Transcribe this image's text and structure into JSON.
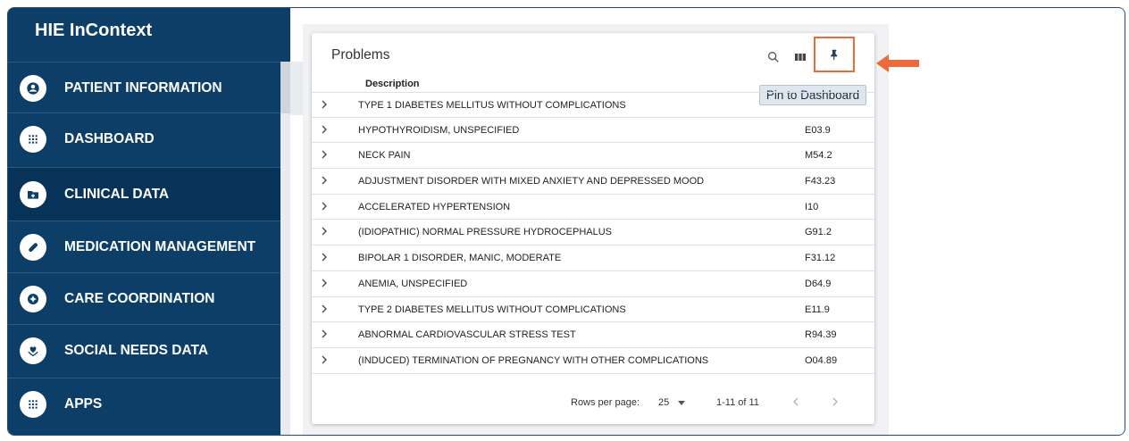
{
  "app": {
    "title": "HIE InContext"
  },
  "sidebar": {
    "items": [
      {
        "label": "PATIENT INFORMATION",
        "icon": "account-circle-icon",
        "active": false
      },
      {
        "label": "DASHBOARD",
        "icon": "grid-icon",
        "active": false
      },
      {
        "label": "CLINICAL DATA",
        "icon": "folder-plus-icon",
        "active": true
      },
      {
        "label": "MEDICATION MANAGEMENT",
        "icon": "pill-icon",
        "active": false
      },
      {
        "label": "CARE COORDINATION",
        "icon": "care-coordination-icon",
        "active": false
      },
      {
        "label": "SOCIAL NEEDS DATA",
        "icon": "heart-hands-icon",
        "active": false
      },
      {
        "label": "APPS",
        "icon": "grid-icon",
        "active": false
      }
    ]
  },
  "problems": {
    "title": "Problems",
    "column_description": "Description",
    "tooltip": "Pin to Dashboard",
    "rows": [
      {
        "description": "TYPE 1 DIABETES MELLITUS WITHOUT COMPLICATIONS",
        "code": ""
      },
      {
        "description": "HYPOTHYROIDISM, UNSPECIFIED",
        "code": "E03.9"
      },
      {
        "description": "NECK PAIN",
        "code": "M54.2"
      },
      {
        "description": "ADJUSTMENT DISORDER WITH MIXED ANXIETY AND DEPRESSED MOOD",
        "code": "F43.23"
      },
      {
        "description": "ACCELERATED HYPERTENSION",
        "code": "I10"
      },
      {
        "description": "(IDIOPATHIC) NORMAL PRESSURE HYDROCEPHALUS",
        "code": "G91.2"
      },
      {
        "description": "BIPOLAR 1 DISORDER, MANIC, MODERATE",
        "code": "F31.12"
      },
      {
        "description": "ANEMIA, UNSPECIFIED",
        "code": "D64.9"
      },
      {
        "description": "TYPE 2 DIABETES MELLITUS WITHOUT COMPLICATIONS",
        "code": "E11.9"
      },
      {
        "description": "ABNORMAL CARDIOVASCULAR STRESS TEST",
        "code": "R94.39"
      },
      {
        "description": "(INDUCED) TERMINATION OF PREGNANCY WITH OTHER COMPLICATIONS",
        "code": "O04.89"
      }
    ],
    "pagination": {
      "rows_per_page_label": "Rows per page:",
      "rows_per_page_value": "25",
      "range": "1-11 of 11"
    }
  },
  "colors": {
    "sidebar_bg": "#0c3e68",
    "highlight": "#ef6a3b"
  }
}
